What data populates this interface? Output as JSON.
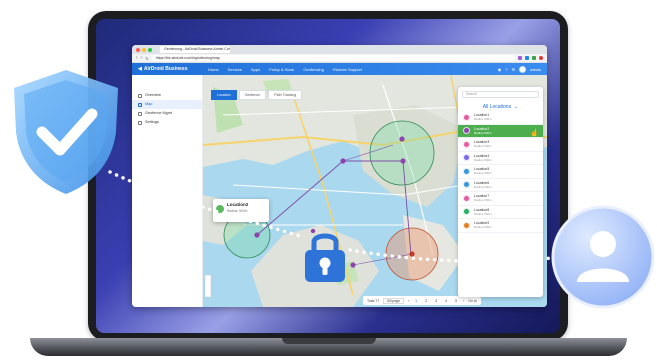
{
  "browser": {
    "tab_title": "Geofencing - AirDroid Business Admin Console",
    "url": "https://biz.airdroid.com/#/geofencing/map"
  },
  "app": {
    "brand": "AirDroid Business",
    "nav": [
      "Home",
      "Devices",
      "Apps",
      "Policy & Kiosk",
      "Geofencing",
      "Remote Support"
    ],
    "user": "admin"
  },
  "sidebar": {
    "items": [
      {
        "label": "Overview",
        "active": false
      },
      {
        "label": "Map",
        "active": true
      },
      {
        "label": "Geofence Mgmt",
        "active": false
      },
      {
        "label": "Settings",
        "active": false
      }
    ]
  },
  "map": {
    "tabs": [
      "Location",
      "Geofence",
      "Path Tracking"
    ],
    "popup": {
      "name": "Location2",
      "sub": "Radius: 500m"
    },
    "pager": {
      "summary": "Total 77",
      "per_page": "50/page",
      "pages": [
        "1",
        "2",
        "3",
        "4",
        "5"
      ],
      "goto": "Go to"
    }
  },
  "panel": {
    "search_placeholder": "Search",
    "header": "All Locations",
    "items": [
      {
        "name": "Location1",
        "sub": "Radius 500m",
        "color": "#e85aa0",
        "selected": false
      },
      {
        "name": "Location2",
        "sub": "Radius 500m",
        "color": "#8e44ad",
        "selected": true
      },
      {
        "name": "Location3",
        "sub": "Radius 500m",
        "color": "#e85aa0",
        "selected": false
      },
      {
        "name": "Location4",
        "sub": "Radius 500m",
        "color": "#7b68ee",
        "selected": false
      },
      {
        "name": "Location5",
        "sub": "Radius 500m",
        "color": "#3498db",
        "selected": false
      },
      {
        "name": "Location6",
        "sub": "Radius 500m",
        "color": "#3498db",
        "selected": false
      },
      {
        "name": "Location7",
        "sub": "Radius 500m",
        "color": "#e85aa0",
        "selected": false
      },
      {
        "name": "Location8",
        "sub": "Radius 500m",
        "color": "#27ae60",
        "selected": false
      },
      {
        "name": "Location9",
        "sub": "Radius 500m",
        "color": "#e67e22",
        "selected": false
      }
    ]
  },
  "colors": {
    "accent": "#1e6fd8",
    "selected_row": "#4cae4c"
  }
}
